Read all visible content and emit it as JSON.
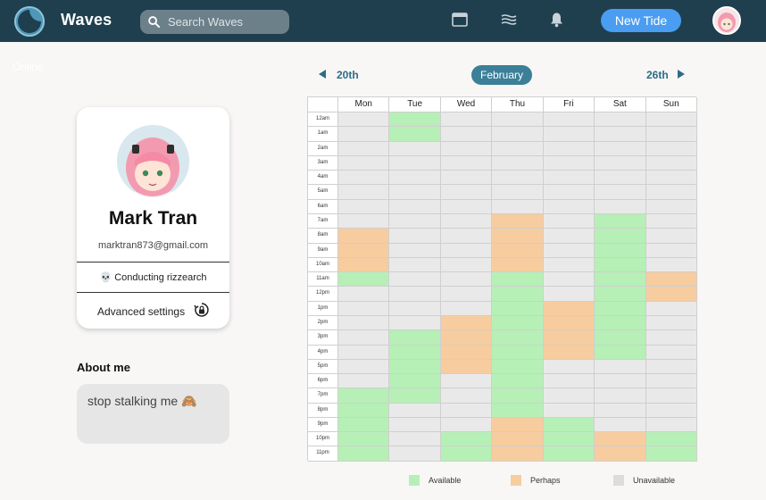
{
  "header": {
    "brand": "Waves",
    "search_placeholder": "Search Waves",
    "new_button": "New Tide",
    "icons": [
      "window-icon",
      "waves-icon",
      "bell-icon"
    ]
  },
  "sidebar": {
    "online_label": "Online",
    "profile": {
      "name": "Mark Tran",
      "email": "marktran873@gmail.com",
      "status": "💀 Conducting rizzearch",
      "advanced_label": "Advanced settings"
    },
    "about": {
      "title": "About me",
      "text": "stop stalking me 🙈"
    }
  },
  "calendar": {
    "prev_label": "20th",
    "month": "February",
    "next_label": "26th",
    "days": [
      "Mon",
      "Tue",
      "Wed",
      "Thu",
      "Fri",
      "Sat",
      "Sun"
    ],
    "hours": [
      "12am",
      "1am",
      "2am",
      "3am",
      "4am",
      "5am",
      "6am",
      "7am",
      "8am",
      "9am",
      "10am",
      "11am",
      "12pm",
      "1pm",
      "2pm",
      "3pm",
      "4pm",
      "5pm",
      "6pm",
      "7pm",
      "8pm",
      "9pm",
      "10pm",
      "11pm"
    ],
    "availability": [
      [
        "u",
        "a",
        "u",
        "u",
        "u",
        "u",
        "u"
      ],
      [
        "u",
        "a",
        "u",
        "u",
        "u",
        "u",
        "u"
      ],
      [
        "u",
        "u",
        "u",
        "u",
        "u",
        "u",
        "u"
      ],
      [
        "u",
        "u",
        "u",
        "u",
        "u",
        "u",
        "u"
      ],
      [
        "u",
        "u",
        "u",
        "u",
        "u",
        "u",
        "u"
      ],
      [
        "u",
        "u",
        "u",
        "u",
        "u",
        "u",
        "u"
      ],
      [
        "u",
        "u",
        "u",
        "u",
        "u",
        "u",
        "u"
      ],
      [
        "u",
        "u",
        "u",
        "p",
        "u",
        "a",
        "u"
      ],
      [
        "p",
        "u",
        "u",
        "p",
        "u",
        "a",
        "u"
      ],
      [
        "p",
        "u",
        "u",
        "p",
        "u",
        "a",
        "u"
      ],
      [
        "p",
        "u",
        "u",
        "p",
        "u",
        "a",
        "u"
      ],
      [
        "a",
        "u",
        "u",
        "a",
        "u",
        "a",
        "p"
      ],
      [
        "u",
        "u",
        "u",
        "a",
        "u",
        "a",
        "p"
      ],
      [
        "u",
        "u",
        "u",
        "a",
        "p",
        "a",
        "u"
      ],
      [
        "u",
        "u",
        "p",
        "a",
        "p",
        "a",
        "u"
      ],
      [
        "u",
        "a",
        "p",
        "a",
        "p",
        "a",
        "u"
      ],
      [
        "u",
        "a",
        "p",
        "a",
        "p",
        "a",
        "u"
      ],
      [
        "u",
        "a",
        "p",
        "a",
        "u",
        "u",
        "u"
      ],
      [
        "u",
        "a",
        "u",
        "a",
        "u",
        "u",
        "u"
      ],
      [
        "a",
        "a",
        "u",
        "a",
        "u",
        "u",
        "u"
      ],
      [
        "a",
        "u",
        "u",
        "a",
        "u",
        "u",
        "u"
      ],
      [
        "a",
        "u",
        "u",
        "p",
        "a",
        "u",
        "u"
      ],
      [
        "a",
        "u",
        "a",
        "p",
        "a",
        "p",
        "a"
      ],
      [
        "a",
        "u",
        "a",
        "p",
        "a",
        "p",
        "a"
      ]
    ],
    "legend": [
      {
        "label": "Available",
        "color": "#b6f0b6"
      },
      {
        "label": "Perhaps",
        "color": "#f7cc9f"
      },
      {
        "label": "Unavailable",
        "color": "#dcdcdc"
      }
    ]
  }
}
